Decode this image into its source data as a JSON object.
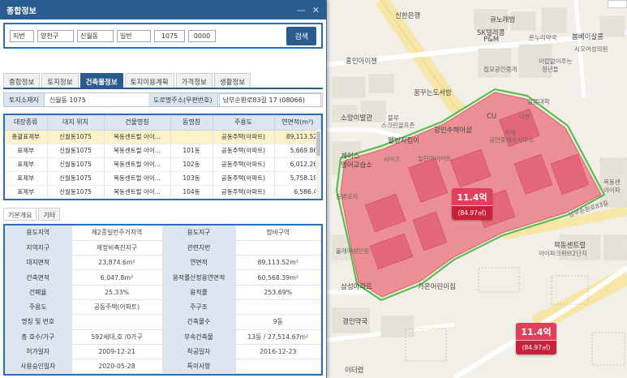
{
  "window": {
    "title": "종합정보",
    "minimize_glyph": "—",
    "close_glyph": "✕"
  },
  "search": {
    "type": "지번",
    "district": "양천구",
    "dong": "신월동",
    "lot_type": "일반",
    "main_no": "1075",
    "sub_no": "0000",
    "button": "검색"
  },
  "tabs": [
    {
      "label": "종합정보",
      "active": false
    },
    {
      "label": "토지정보",
      "active": false
    },
    {
      "label": "건축물정보",
      "active": true
    },
    {
      "label": "토지이용계획",
      "active": false
    },
    {
      "label": "가격정보",
      "active": false
    },
    {
      "label": "생활정보",
      "active": false
    }
  ],
  "address": {
    "land_label": "토지소재지",
    "land_value": "신월동 1075",
    "road_label": "도로명주소(우편번호)",
    "road_value": "남부순환로83길 17 (08066)"
  },
  "building_table": {
    "headers": [
      "대장종류",
      "대지 위치",
      "건물명칭",
      "동명칭",
      "주용도",
      "연면적(m²)"
    ],
    "rows": [
      [
        "총괄표제부",
        "신월동1075",
        "목동센트럴 아이...",
        "",
        "공동주택(아파트)",
        "89,113.52"
      ],
      [
        "표제부",
        "신월동1075",
        "목동센트럴 아이...",
        "101동",
        "공동주택(아파트)",
        "5,669.86"
      ],
      [
        "표제부",
        "신월동1075",
        "목동센트럴 아이...",
        "102동",
        "공동주택(아파트)",
        "6,012.26"
      ],
      [
        "표제부",
        "신월동1075",
        "목동센트럴 아이...",
        "103동",
        "공동주택(아파트)",
        "5,758.18"
      ],
      [
        "표제부",
        "신월동1075",
        "목동센트럴 아이...",
        "104동",
        "공동주택(아파트)",
        "6,586.4"
      ]
    ]
  },
  "detail_tabs": [
    {
      "label": "기본개요",
      "active": true
    },
    {
      "label": "기타",
      "active": false
    }
  ],
  "detail": [
    [
      "용도지역",
      "제2종일반주거지역",
      "용도지구",
      "정비구역"
    ],
    [
      "지역지구",
      "재정비촉진지구",
      "관련지번",
      ""
    ],
    [
      "대지면적",
      "23,874.6m²",
      "연면적",
      "89,113.52m²"
    ],
    [
      "건축면적",
      "6,047.8m²",
      "용적률산정용연면적",
      "60,568.39m²"
    ],
    [
      "건폐율",
      "25.33%",
      "용적률",
      "253.69%"
    ],
    [
      "주용도",
      "공동주택(아파트)",
      "주구조",
      ""
    ],
    [
      "명칭 및 번호",
      "",
      "건축물수",
      "9동"
    ],
    [
      "총 호수/가구",
      "592세대,호 /0가구",
      "부속건축물",
      "13동 / 27,514.67m²"
    ],
    [
      "허가일자",
      "2009-12-21",
      "착공일자",
      "2016-12-23"
    ],
    [
      "사용승인일자",
      "2020-05-28",
      "특이사항",
      ""
    ]
  ],
  "map": {
    "badges": [
      {
        "price": "11.4억",
        "area": "(84.97㎡)"
      },
      {
        "price": "11.4억",
        "area": "(84.97㎡)"
      }
    ],
    "labels": [
      "신한은행",
      "큐노래방",
      "SK텔레콤",
      "P&M",
      "온누리약국",
      "봄베이살롱",
      "시오여성의원",
      "홍인아이젠",
      "집모공인중개",
      "아랍없이주는",
      "청년들",
      "꿈꾸는도서방",
      "소망이발관",
      "블루",
      "스크린골프존",
      "강민수헤어샵",
      "CU",
      "일류대학",
      "더몬",
      "미래",
      "공인중개사사무소",
      "웰빙지킴이",
      "게이스",
      "영어교습소",
      "사이즈",
      "놀란마이어트",
      "목동센",
      "아이파",
      "목동센트럴",
      "아이파크위브2단지",
      "올레아성인원",
      "삼성아파트",
      "가온어린이집",
      "경인약국",
      "이터렸",
      "동방포차",
      "남부순환로83길",
      "금장",
      "학원",
      "편의점",
      "사우나",
      "보건소"
    ]
  }
}
